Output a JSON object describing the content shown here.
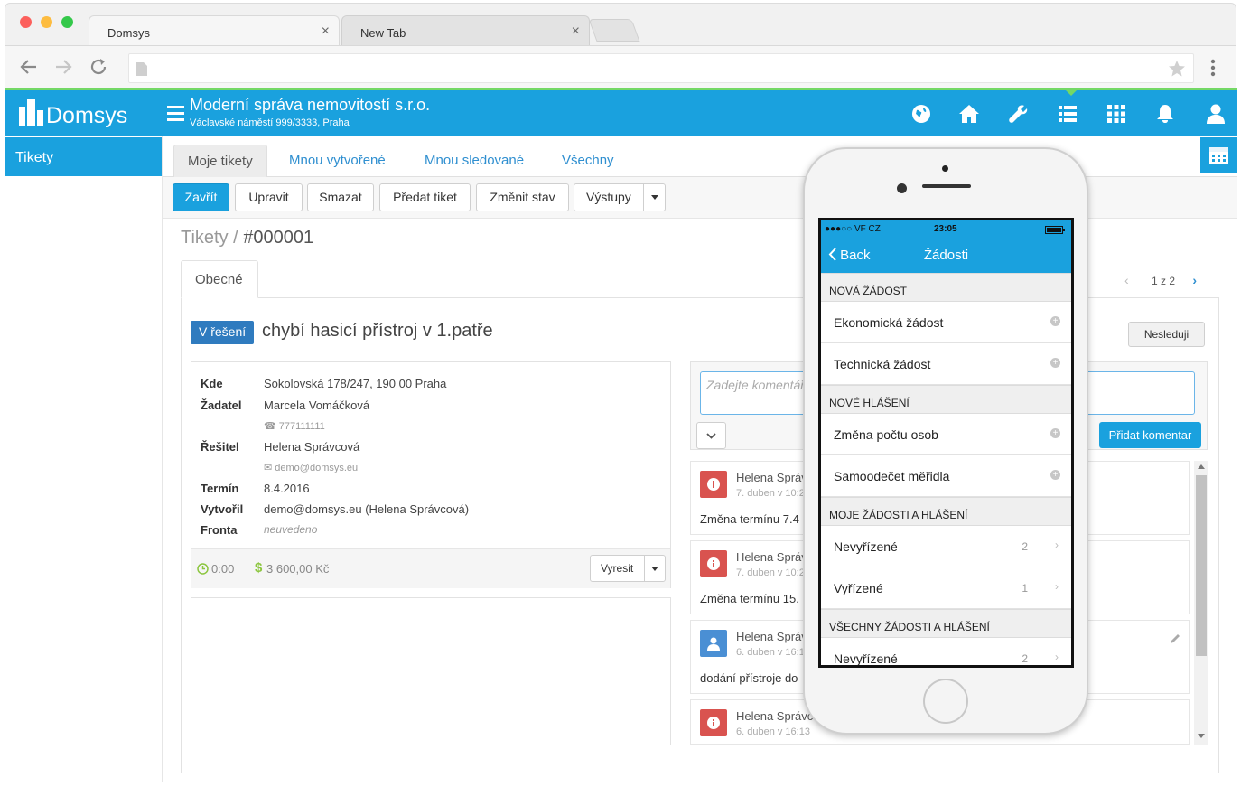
{
  "browser": {
    "tabs": [
      {
        "label": "Domsys",
        "active": true
      },
      {
        "label": "New Tab",
        "active": false
      }
    ],
    "tab_close": "×",
    "nav_icons": [
      "back-icon",
      "forward-icon",
      "reload-icon",
      "page-icon",
      "star-icon",
      "menu-icon"
    ]
  },
  "header": {
    "logo": "Domsys",
    "company_name": "Moderní správa nemovitostí s.r.o.",
    "company_address": "Václavské náměstí 999/3333, Praha",
    "accent_color": "#1aa1de",
    "icons": [
      "globe-icon",
      "home-icon",
      "wrench-icon",
      "list-icon",
      "grid-icon",
      "bell-icon",
      "user-icon"
    ]
  },
  "sidebar": {
    "items": [
      {
        "label": "Tikety",
        "active": true
      }
    ]
  },
  "main": {
    "tabs": [
      {
        "label": "Moje tikety",
        "active": true
      },
      {
        "label": "Mnou vytvořené"
      },
      {
        "label": "Mnou sledované"
      },
      {
        "label": "Všechny"
      }
    ],
    "actions": [
      "Zavřít",
      "Upravit",
      "Smazat",
      "Předat tiket",
      "Změnit stav",
      "Výstupy"
    ],
    "breadcrumb": {
      "root": "Tikety",
      "separator": " / ",
      "current": "#000001"
    },
    "detail_tab": "Obecné",
    "pager": "1 z 2",
    "status_badge": "V řešení",
    "ticket_title": "chybí hasicí přístroj v 1.patře",
    "follow_button": "Nesleduji",
    "details": {
      "kde_label": "Kde",
      "kde_value": "Sokolovská 178/247, 190 00 Praha",
      "zadatel_label": "Žadatel",
      "zadatel_value": "Marcela Vomáčková",
      "zadatel_phone": "777111111",
      "resitel_label": "Řešitel",
      "resitel_value": "Helena Správcová",
      "resitel_email": "demo@domsys.eu",
      "termin_label": "Termín",
      "termin_value": "8.4.2016",
      "vytvoril_label": "Vytvořil",
      "vytvoril_value": "demo@domsys.eu (Helena Správcová)",
      "fronta_label": "Fronta",
      "fronta_value": "neuvedeno",
      "time": "0:00",
      "cost": "3 600,00 Kč",
      "resolve_button": "Vyresit"
    },
    "comment": {
      "placeholder": "Zadejte komentář",
      "send_button": "Přidat komentar"
    },
    "feed": [
      {
        "author": "Helena Správ",
        "date": "7. duben v 10:2",
        "text": "Změna termínu 7.4",
        "icon": "info-icon",
        "color": "#d9534f"
      },
      {
        "author": "Helena Správ",
        "date": "7. duben v 10:2",
        "text": "Změna termínu 15.",
        "icon": "info-icon",
        "color": "#d9534f"
      },
      {
        "author": "Helena Správ",
        "date": "6. duben v 16:1",
        "text": "dodání přístroje do",
        "icon": "user-icon",
        "color": "#4a8fd4"
      },
      {
        "author": "Helena Správc",
        "date": "6. duben v 16:13",
        "text": "",
        "icon": "info-icon",
        "color": "#d9534f"
      }
    ]
  },
  "phone": {
    "status": {
      "carrier": "●●●○○ VF CZ",
      "time": "23:05"
    },
    "nav": {
      "back": "Back",
      "title": "Žádosti"
    },
    "sections": [
      {
        "title": "NOVÁ ŽÁDOST",
        "rows": [
          {
            "label": "Ekonomická žádost",
            "type": "plus"
          },
          {
            "label": "Technická žádost",
            "type": "plus"
          }
        ]
      },
      {
        "title": "NOVÉ HLÁŠENÍ",
        "rows": [
          {
            "label": "Změna počtu osob",
            "type": "plus"
          },
          {
            "label": "Samoodečet měřidla",
            "type": "plus"
          }
        ]
      },
      {
        "title": "MOJE ŽÁDOSTI A HLÁŠENÍ",
        "rows": [
          {
            "label": "Nevyřízené",
            "count": "2",
            "type": "chevron"
          },
          {
            "label": "Vyřízené",
            "count": "1",
            "type": "chevron"
          }
        ]
      },
      {
        "title": "VŠECHNY ŽÁDOSTI A HLÁŠENÍ",
        "rows": [
          {
            "label": "Nevyřízené",
            "count": "2",
            "type": "chevron"
          }
        ]
      }
    ]
  }
}
